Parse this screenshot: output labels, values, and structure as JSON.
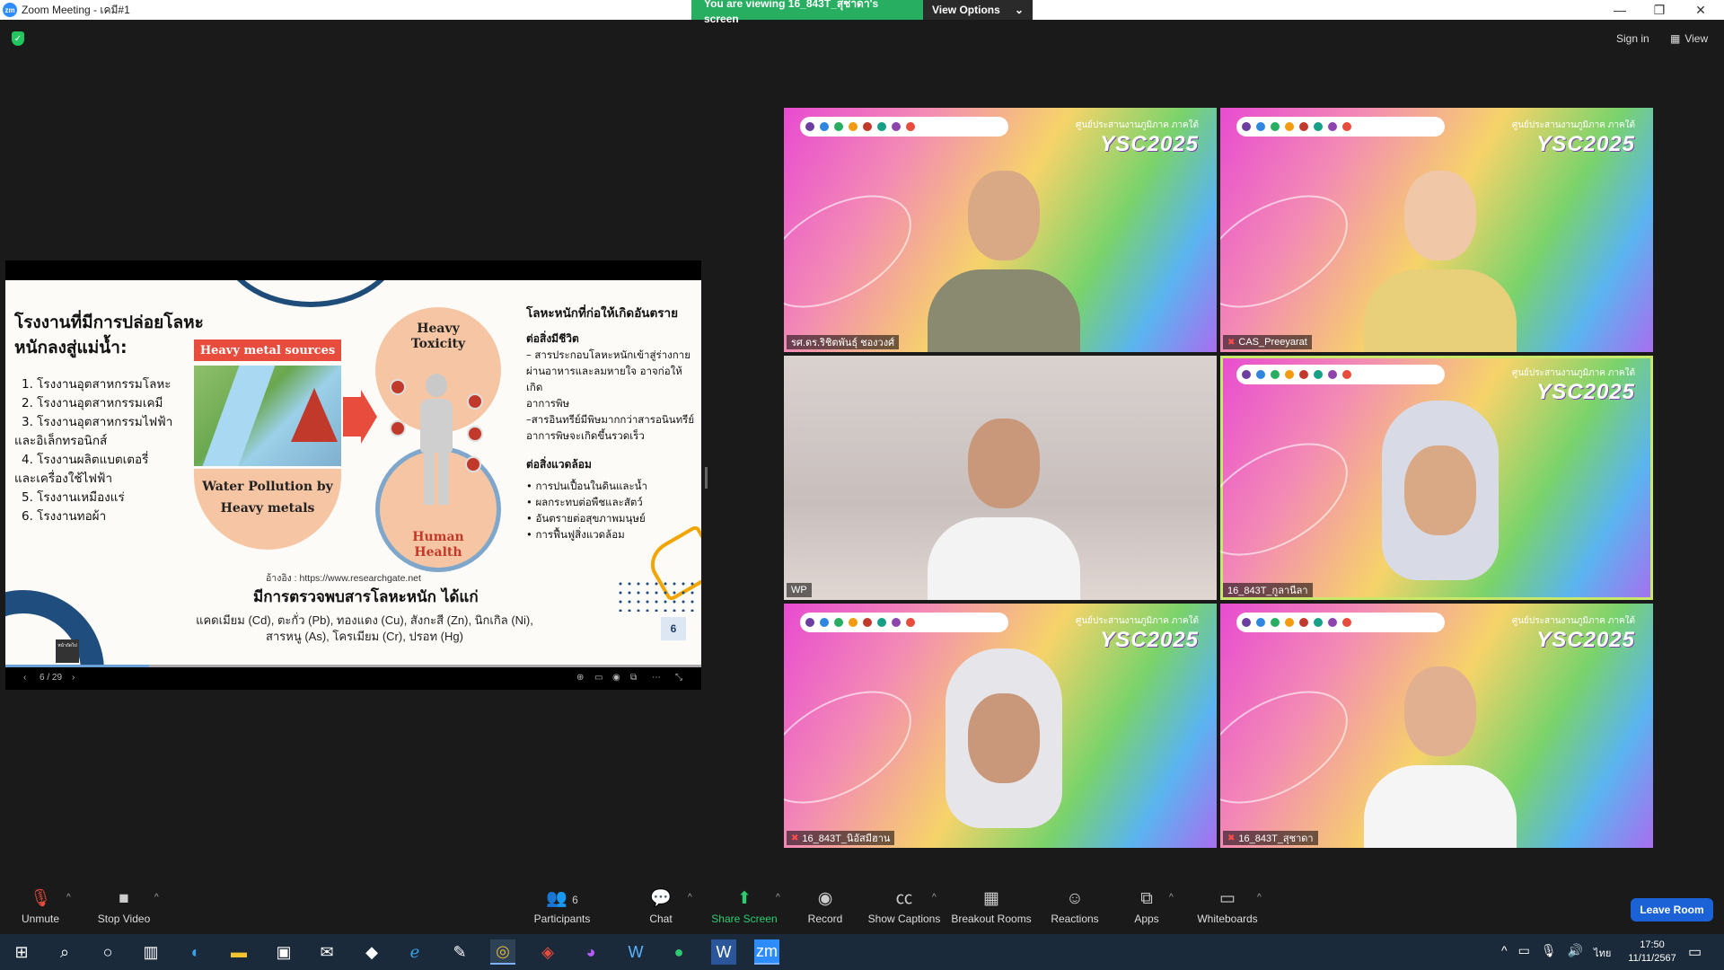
{
  "window": {
    "title": "Zoom Meeting - เคมี#1",
    "logo_text": "zm",
    "minimize": "—",
    "maximize": "❐",
    "close": "✕"
  },
  "banner": {
    "message": "You are viewing 16_843T_สุชาดา's screen",
    "view_options": "View Options",
    "caret": "⌄"
  },
  "top_right": {
    "sign_in": "Sign in",
    "view": "View"
  },
  "slide": {
    "title_line1": "โรงงานที่มีการปล่อยโลหะ",
    "title_line2": "หนักลงสู่แม่น้ำ:",
    "list": [
      "1. โรงงานอุตสาหกรรมโลหะ",
      "2. โรงงานอุตสาหกรรมเคมี",
      "3. โรงงานอุตสาหกรรมไฟฟ้า",
      "และอิเล็กทรอนิกส์",
      "4. โรงงานผลิตแบตเตอรี่",
      "และเครื่องใช้ไฟฟ้า",
      "5. โรงงานเหมืองแร่",
      "6. โรงงานทอผ้า"
    ],
    "heavy_metal_sources": "Heavy metal sources",
    "water_pollution_line1": "Water Pollution by",
    "water_pollution_line2": "Heavy metals",
    "heavy_toxicity_line1": "Heavy",
    "heavy_toxicity_line2": "Toxicity",
    "human_health_line1": "Human",
    "human_health_line2": "Health",
    "right_heading": "โลหะหนักที่ก่อให้เกิดอันตราย",
    "living_heading": "ต่อสิ่งมีชีวิต",
    "living_items": [
      "– สารประกอบโลหะหนักเข้าสู่ร่างกาย",
      "ผ่านอาหารและลมหายใจ อาจก่อให้เกิด",
      "อาการพิษ",
      "–สารอินทรีย์มีพิษมากกว่าสารอนินทรีย์",
      "อาการพิษจะเกิดขึ้นรวดเร็ว"
    ],
    "env_heading": "ต่อสิ่งแวดล้อม",
    "env_items": [
      "• การปนเปื้อนในดินและน้ำ",
      "• ผลกระทบต่อพืชและสัตว์",
      "• อันตรายต่อสุขภาพมนุษย์",
      "• การฟื้นฟูสิ่งแวดล้อม"
    ],
    "reference": "อ้างอิง : https://www.researchgate.net",
    "found_heading": "มีการตรวจพบสารโลหะหนัก ได้แก่",
    "metals_line1": "แคดเมียม (Cd), ตะกั่ว (Pb), ทองแดง (Cu), สังกะสี (Zn), นิกเกิล (Ni),",
    "metals_line2": "สารหนู (As), โครเมียม (Cr), ปรอท (Hg)",
    "page_number": "6",
    "note_label": "หน้าถัดไป"
  },
  "share_controls": {
    "prev": "‹",
    "page": "6 / 29",
    "next": "›",
    "zoom": "⊕",
    "captions": "▭",
    "audio": "◉",
    "present": "⧉",
    "more": "⋯",
    "collapse": "⤡"
  },
  "videos": [
    {
      "name": "รศ.ดร.ริชิตพันธุ์ ชองวงศ์",
      "muted": false
    },
    {
      "name": "CAS_Preeyarat",
      "muted": true
    },
    {
      "name": "WP",
      "muted": false
    },
    {
      "name": "16_843T_กูลานีลา",
      "muted": false
    },
    {
      "name": "16_843T_นิอัสมีฮาน",
      "muted": true
    },
    {
      "name": "16_843T_สุชาดา",
      "muted": true
    }
  ],
  "tile_branding": {
    "subtitle": "ศูนย์ประสานงานภูมิภาค ภาคใต้",
    "event": "YSC2025"
  },
  "toolbar": {
    "unmute": "Unmute",
    "stop_video": "Stop Video",
    "participants": "Participants",
    "participants_count": "6",
    "chat": "Chat",
    "share_screen": "Share Screen",
    "record": "Record",
    "show_captions": "Show Captions",
    "breakout_rooms": "Breakout Rooms",
    "reactions": "Reactions",
    "apps": "Apps",
    "whiteboards": "Whiteboards",
    "leave_room": "Leave Room"
  },
  "taskbar": {
    "language": "ไทย",
    "time": "17:50",
    "date": "11/11/2567"
  },
  "colors": {
    "banner_green": "#27ae60",
    "leave_blue": "#1a62d6",
    "share_green": "#2ecc71",
    "active_speaker": "#c8e86a"
  }
}
